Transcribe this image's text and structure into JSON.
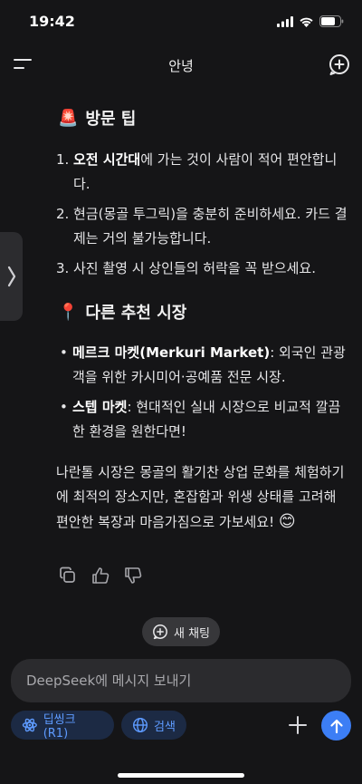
{
  "status_bar": {
    "time": "19:42"
  },
  "header": {
    "title": "안녕"
  },
  "tips": {
    "emoji": "🚨",
    "heading": "방문 팁",
    "items": [
      {
        "num": "1.",
        "bold": "오전 시간대",
        "text": "에 가는 것이 사람이 적어 편안합니다."
      },
      {
        "num": "2.",
        "text": "현금(몽골 투그릭)을 충분히 준비하세요. 카드 결제는 거의 불가능합니다."
      },
      {
        "num": "3.",
        "text": "사진 촬영 시 상인들의 허락을 꼭 받으세요."
      }
    ]
  },
  "markets": {
    "emoji": "📍",
    "heading": "다른 추천 시장",
    "items": [
      {
        "bold": "메르크 마켓(Merkuri Market)",
        "text": ": 외국인 관광객을 위한 카시미어·공예품 전문 시장."
      },
      {
        "bold": "스텝 마켓",
        "text": ": 현대적인 실내 시장으로 비교적 깔끔한 환경을 원한다면!"
      }
    ]
  },
  "closing": {
    "text": "나란톨 시장은 몽골의 활기찬 상업 문화를 체험하기에 최적의 장소지만, 혼잡함과 위생 상태를 고려해 편안한 복장과 마음가짐으로 가보세요!",
    "emoji": "😊"
  },
  "new_chat_label": "새 채팅",
  "composer": {
    "placeholder": "DeepSeek에 메시지 보내기",
    "deepthink_label": "딥씽크 (R1)",
    "search_label": "검색"
  },
  "colors": {
    "accent": "#3c7ef5",
    "chip_text": "#5e9bff",
    "background": "#151517"
  }
}
